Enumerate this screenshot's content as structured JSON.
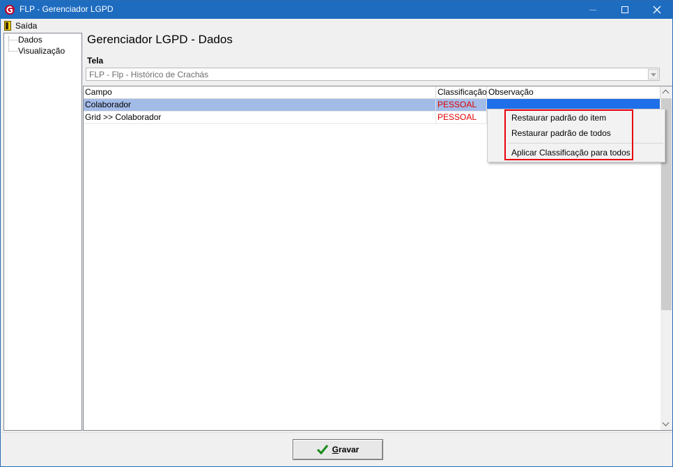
{
  "window": {
    "title": "FLP - Gerenciador LGPD",
    "controls": [
      "minimize",
      "maximize",
      "close"
    ]
  },
  "menubar": {
    "saida_label": "Saída"
  },
  "tree": {
    "items": [
      {
        "label": "Dados"
      },
      {
        "label": "Visualização"
      }
    ]
  },
  "main": {
    "page_title": "Gerenciador LGPD - Dados",
    "tela_label": "Tela",
    "tela_value": "FLP - Flp - Histórico de Crachás"
  },
  "grid": {
    "columns": [
      "Campo",
      "Classificação",
      "Observação"
    ],
    "rows": [
      {
        "campo": "Colaborador",
        "classificacao": "PESSOAL",
        "observacao": ""
      },
      {
        "campo": "Grid >> Colaborador",
        "classificacao": "PESSOAL",
        "observacao": ""
      }
    ],
    "selected_row": 0
  },
  "context_menu": {
    "items": [
      {
        "label": "Restaurar padrão do item"
      },
      {
        "label": "Restaurar padrão de todos"
      },
      {
        "label": "Aplicar Classificação para todos"
      }
    ]
  },
  "footer": {
    "gravar_label_prefix": "G",
    "gravar_label_rest": "ravar"
  },
  "colors": {
    "titlebar": "#1e6cc0",
    "selection_row": "#a3bbe7",
    "selection_cell": "#1f6fe8",
    "classification_text": "#e00000",
    "highlight_border": "#e8000b",
    "check_icon": "#1a8a1a"
  },
  "icons": {
    "app": "flp-logo-icon",
    "saida": "exit-door-icon",
    "gravar": "check-icon"
  }
}
